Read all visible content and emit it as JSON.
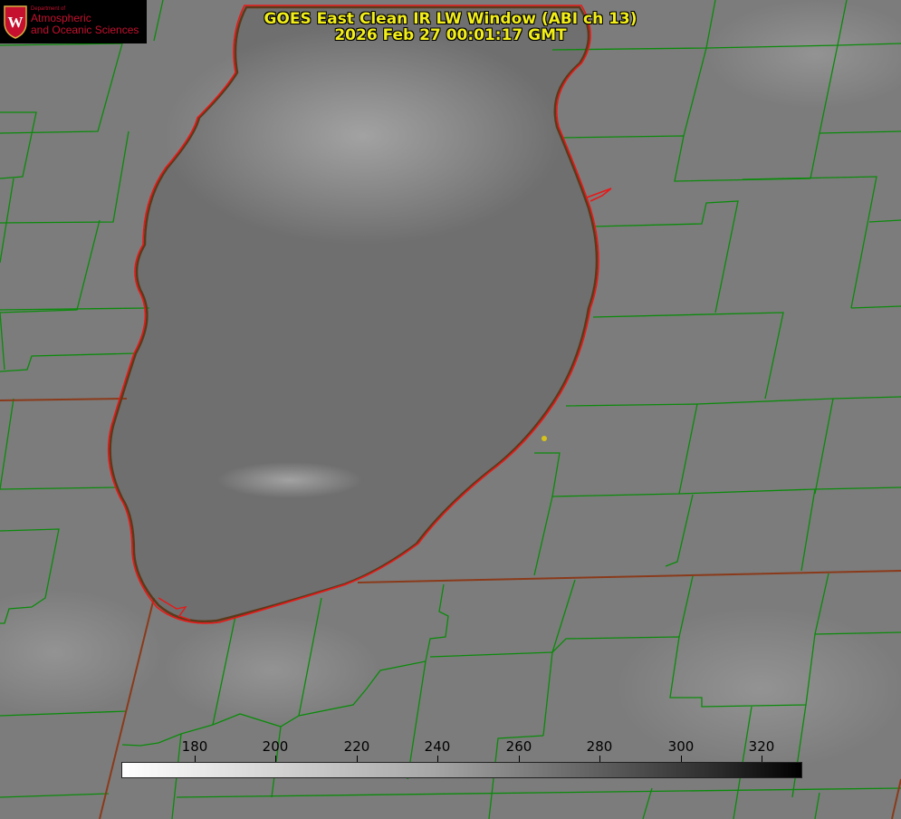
{
  "title_line1": "GOES East Clean IR LW Window (ABI ch 13)",
  "title_line2": "2026 Feb 27 00:01:17 GMT",
  "logo": {
    "department": "Department of",
    "line1": "Atmospheric",
    "line2": "and Oceanic Sciences"
  },
  "colorbar": {
    "units_min": 162,
    "units_max": 330,
    "ticks": [
      "180",
      "200",
      "220",
      "240",
      "260",
      "280",
      "300",
      "320"
    ]
  },
  "colors": {
    "title": "#f2ee1a",
    "county_lines": "#0a8a0a",
    "coastline": "#e81818",
    "state_lines": "#8a3a1a",
    "logo_red": "#c5102f"
  }
}
